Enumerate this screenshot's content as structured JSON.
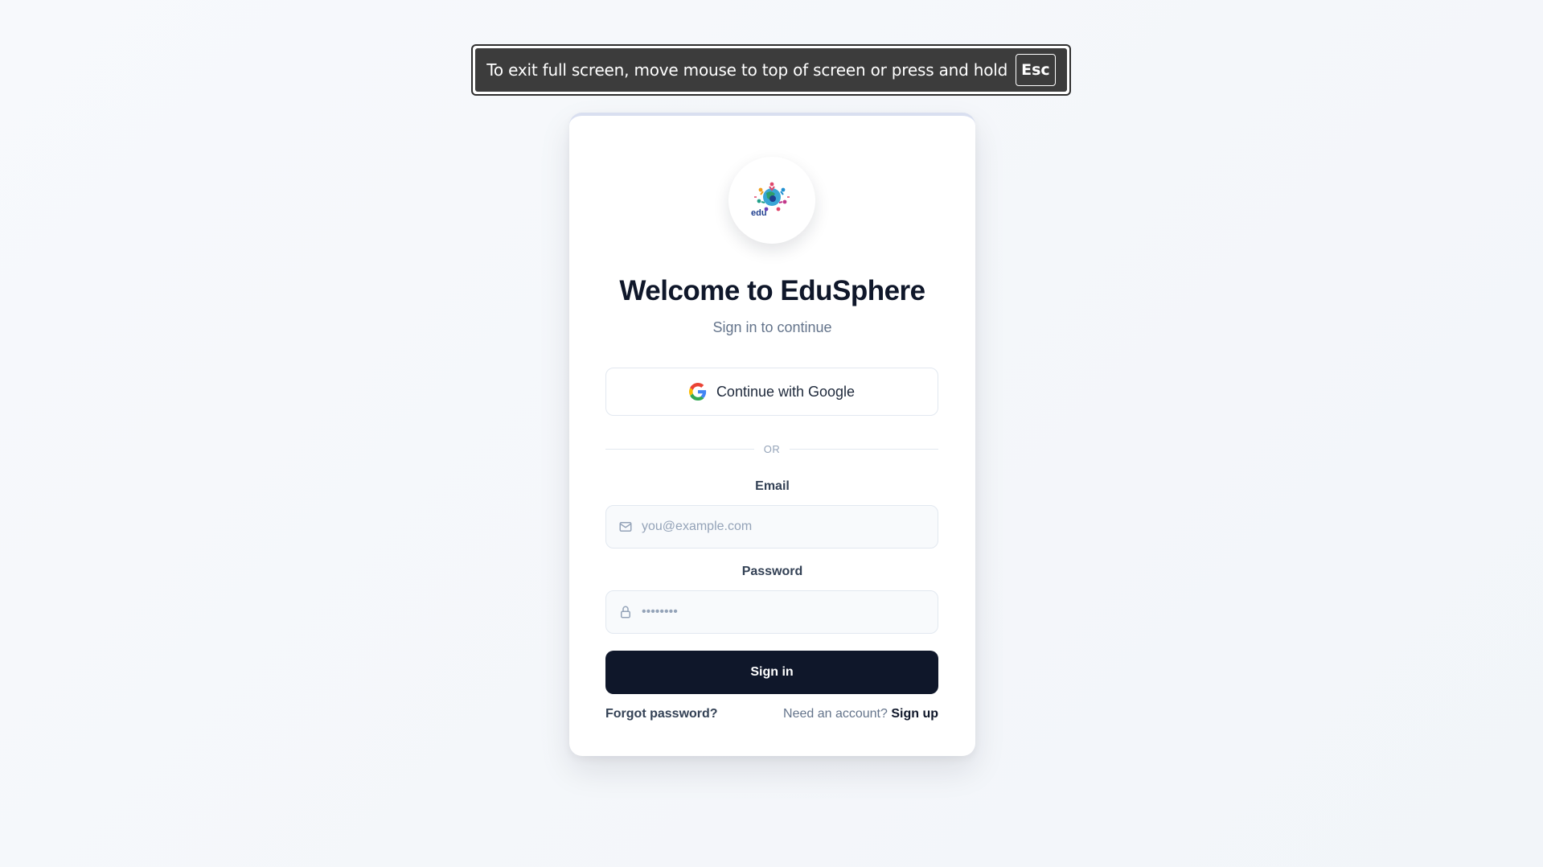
{
  "fullscreen_notice": {
    "message": "To exit full screen, move mouse to top of screen or press and hold",
    "key": "Esc"
  },
  "login": {
    "logo_icon": "edusphere-logo",
    "logo_text": "edu",
    "title": "Welcome to EduSphere",
    "subtitle": "Sign in to continue",
    "google_button_label": "Continue with Google",
    "divider_text": "OR",
    "email": {
      "label": "Email",
      "placeholder": "you@example.com",
      "value": "",
      "icon": "mail-icon"
    },
    "password": {
      "label": "Password",
      "placeholder": "••••••••",
      "value": "",
      "icon": "lock-icon"
    },
    "signin_button_label": "Sign in",
    "forgot_password_label": "Forgot password?",
    "need_account_text": "Need an account?",
    "signup_label": "Sign up"
  },
  "colors": {
    "primary_button": "#0f172a",
    "background": "#f5f7fa",
    "muted_text": "#64748b"
  }
}
